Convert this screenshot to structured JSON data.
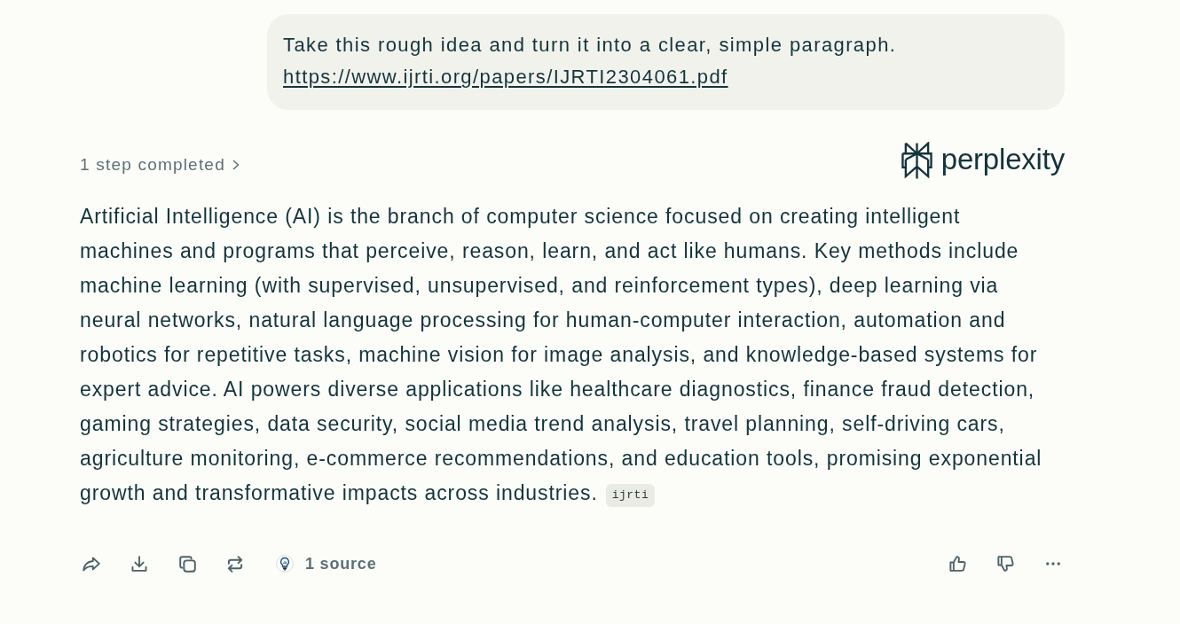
{
  "user_message": {
    "text": "Take this rough idea and turn it into a clear, simple paragraph.",
    "link": "https://www.ijrti.org/papers/IJRTI2304061.pdf"
  },
  "steps": {
    "label": "1 step completed",
    "expanded": false
  },
  "brand": {
    "wordmark": "perplexity"
  },
  "answer": {
    "text": "Artificial Intelligence (AI) is the branch of computer science focused on creating intelligent machines and programs that perceive, reason, learn, and act like humans. Key methods include machine learning (with supervised, unsupervised, and reinforcement types), deep learning via neural networks, natural language processing for human-computer interaction, automation and robotics for repetitive tasks, machine vision for image analysis, and knowledge-based systems for expert advice. AI powers diverse applications like healthcare diagnostics, finance fraud detection, gaming strategies, data security, social media trend analysis, travel planning, self-driving cars, agriculture monitoring, e-commerce recommendations, and education tools, promising exponential growth and transformative impacts across industries.",
    "citations": [
      "ijrti"
    ]
  },
  "sources": {
    "label": "1 source"
  }
}
